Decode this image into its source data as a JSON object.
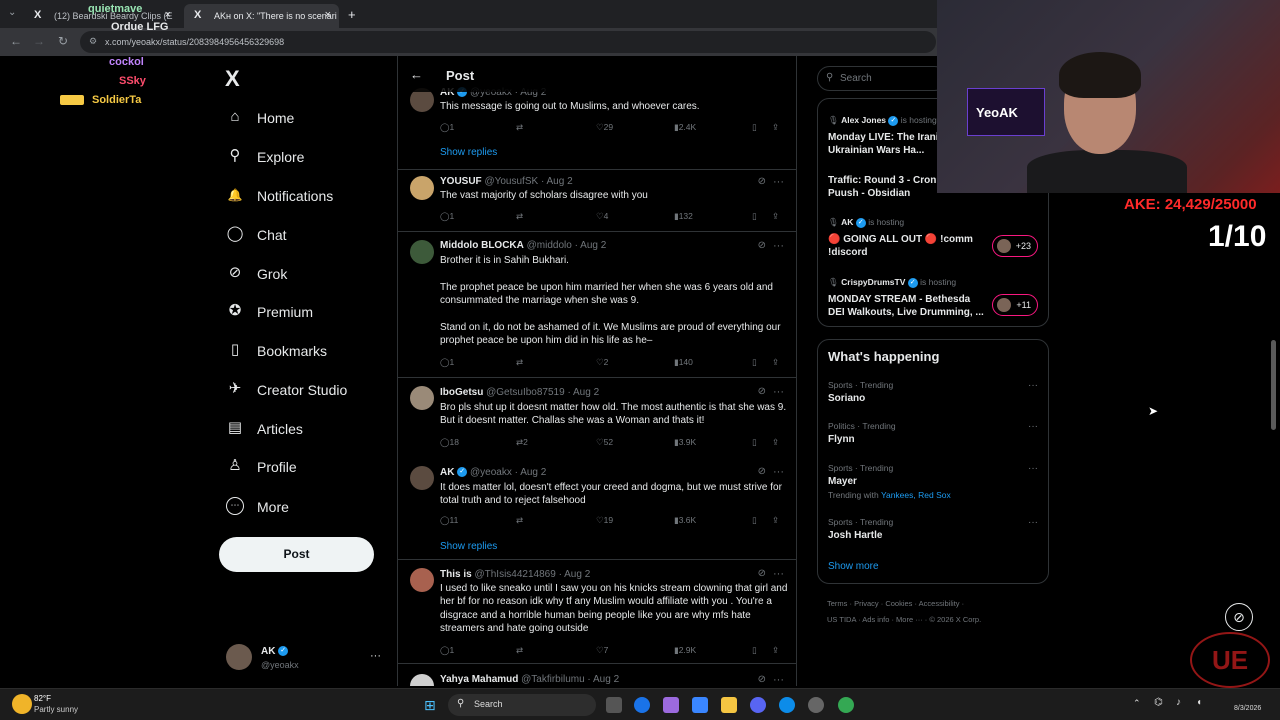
{
  "browser": {
    "tabs": [
      {
        "label": "(12) Beardski Beardy Clips (E"
      },
      {
        "label": "AKʜ on X: \"There is no scenari"
      }
    ],
    "new_tab": "+",
    "url": "x.com/yeoakx/status/2083984956456329698"
  },
  "chat_overlay": {
    "names": [
      {
        "name": "quietmave",
        "color": "#9ae6b4"
      },
      {
        "name": "Ordue",
        "color": "#ffffff"
      },
      {
        "name": "LFG",
        "color": "#ffffff"
      },
      {
        "name": "cockol",
        "color": "#c084fc"
      },
      {
        "name": "SSky",
        "color": "#ff4d6d"
      },
      {
        "name": "SoldierTa",
        "color": "#f6c944"
      }
    ]
  },
  "sidebar": {
    "logo": "X",
    "items": [
      {
        "label": "Home",
        "icon": "⌂"
      },
      {
        "label": "Explore",
        "icon": "⚲"
      },
      {
        "label": "Notifications",
        "icon": "🔔"
      },
      {
        "label": "Chat",
        "icon": "◯"
      },
      {
        "label": "Grok",
        "icon": "⊘"
      },
      {
        "label": "Premium",
        "icon": "✪"
      },
      {
        "label": "Bookmarks",
        "icon": "▯"
      },
      {
        "label": "Creator Studio",
        "icon": "✈"
      },
      {
        "label": "Articles",
        "icon": "▤"
      },
      {
        "label": "Profile",
        "icon": "♙"
      },
      {
        "label": "More",
        "icon": "⋯"
      }
    ],
    "post_button": "Post",
    "account": {
      "name": "AK",
      "handle": "@yeoakx",
      "more": "···"
    }
  },
  "feed": {
    "title": "Post",
    "back": "←",
    "show_replies": "Show replies",
    "tweets": [
      {
        "name": "AK",
        "handle": "@yeoakx",
        "date": "Aug 2",
        "text": "This message is going out to Muslims, and whoever cares.",
        "replies": "1",
        "retweets": "",
        "likes": "29",
        "views": "2.4K"
      },
      {
        "name": "YOUSUF",
        "handle": "@YousufSK",
        "date": "Aug 2",
        "text": "The vast majority of scholars disagree with you",
        "replies": "1",
        "retweets": "",
        "likes": "4",
        "views": "132"
      },
      {
        "name": "Middolo BLOCKA",
        "handle": "@middolo",
        "date": "Aug 2",
        "text": "Brother it is in Sahih Bukhari.\n\nThe prophet peace be upon him married her when she was 6 years old and consummated the marriage when she was 9.\n\nStand on it, do not be ashamed of it. We Muslims are proud of everything our prophet peace be upon him did in his life as he–",
        "replies": "1",
        "retweets": "",
        "likes": "2",
        "views": "140"
      },
      {
        "name": "IboGetsu",
        "handle": "@GetsuIbo87519",
        "date": "Aug 2",
        "text": "Bro pls shut up it doesnt matter how old. The most authentic is that she was 9. But it doesnt matter. Challas she was a Woman and thats it!",
        "replies": "18",
        "retweets": "2",
        "likes": "52",
        "views": "3.9K"
      },
      {
        "name": "AK",
        "handle": "@yeoakx",
        "date": "Aug 2",
        "text": "It does matter lol, doesn't effect your creed and dogma, but we must strive for total truth and to reject falsehood",
        "replies": "11",
        "retweets": "",
        "likes": "19",
        "views": "3.6K"
      },
      {
        "name": "This is",
        "handle": "@ThIsis44214869",
        "date": "Aug 2",
        "text": "I used to like sneako until I saw you on his knicks stream clowning that girl and her bf for no reason idk why tf any Muslim would affiliate with you . You're a disgrace and a horrible human being people like you are why mfs hate streamers and hate going outside",
        "replies": "1",
        "retweets": "",
        "likes": "7",
        "views": "2.9K"
      },
      {
        "name": "Yahya Mahamud",
        "handle": "@Takfirbilumu",
        "date": "Aug 2",
        "text": "",
        "replies": "",
        "retweets": "",
        "likes": "",
        "views": ""
      }
    ]
  },
  "right": {
    "search_placeholder": "Search",
    "spaces": [
      {
        "host": "Alex Jones",
        "status": "is hosting",
        "title": "Monday LIVE: The Irani... And Ukrainian Wars Ha...",
        "count": ""
      },
      {
        "host": "",
        "status": "",
        "title": "Traffic: Round 3 - Cron... #CRO - Puush - Obsidian",
        "count": ""
      },
      {
        "host": "AK",
        "status": "is hosting",
        "title": "🔴 GOING ALL OUT 🔴 !comm !discord",
        "count": "+23"
      },
      {
        "host": "CrispyDrumsTV",
        "status": "is hosting",
        "title": "MONDAY STREAM - Bethesda DEI Walkouts, Live Drumming, ...",
        "count": "+11"
      }
    ],
    "happening_title": "What's happening",
    "trends": [
      {
        "category": "Sports · Trending",
        "name": "Soriano",
        "with_label": "",
        "with": ""
      },
      {
        "category": "Politics · Trending",
        "name": "Flynn",
        "with_label": "",
        "with": ""
      },
      {
        "category": "Sports · Trending",
        "name": "Mayer",
        "with_label": "Trending with",
        "with": "Yankees, Red Sox"
      },
      {
        "category": "Sports · Trending",
        "name": "Josh Hartle",
        "with_label": "",
        "with": ""
      }
    ],
    "show_more": "Show more",
    "footer1": "Terms  ·  Privacy  ·  Cookies  ·  Accessibility  ·",
    "footer2": "US TIDA  ·  Ads info  ·  More ···  ·  © 2026 X Corp."
  },
  "stream": {
    "monitor_text": "YeoAK",
    "goal": "AKE: 24,429/25000",
    "counter": "1/10"
  },
  "taskbar": {
    "weather_temp": "82°F",
    "weather_desc": "Partly sunny",
    "search": "Search",
    "date": "8/3/2026"
  },
  "colors": {
    "accent": "#1d9bf0",
    "background": "#000000",
    "goal": "#ff2a2a"
  }
}
